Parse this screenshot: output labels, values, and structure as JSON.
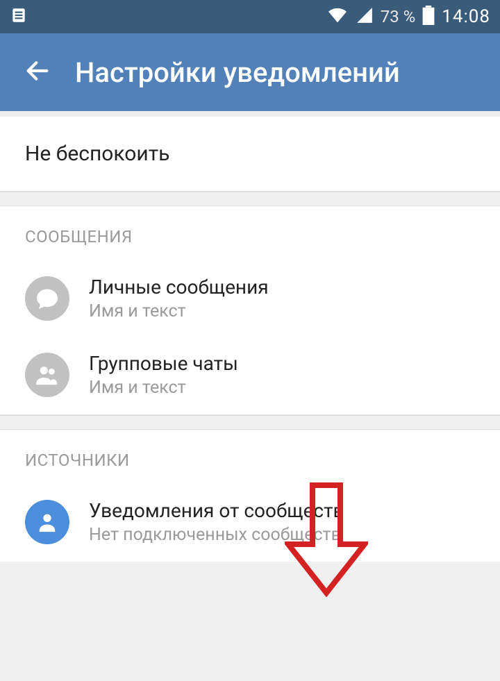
{
  "statusBar": {
    "battery": "73 %",
    "time": "14:08"
  },
  "appBar": {
    "title": "Настройки уведомлений"
  },
  "dnd": {
    "label": "Не беспокоить"
  },
  "sections": {
    "messages": {
      "header": "СООБЩЕНИЯ",
      "items": [
        {
          "title": "Личные сообщения",
          "sub": "Имя и текст"
        },
        {
          "title": "Групповые чаты",
          "sub": "Имя и текст"
        }
      ]
    },
    "sources": {
      "header": "ИСТОЧНИКИ",
      "items": [
        {
          "title": "Уведомления от сообществ",
          "sub": "Нет подключенных сообществ"
        }
      ]
    }
  }
}
